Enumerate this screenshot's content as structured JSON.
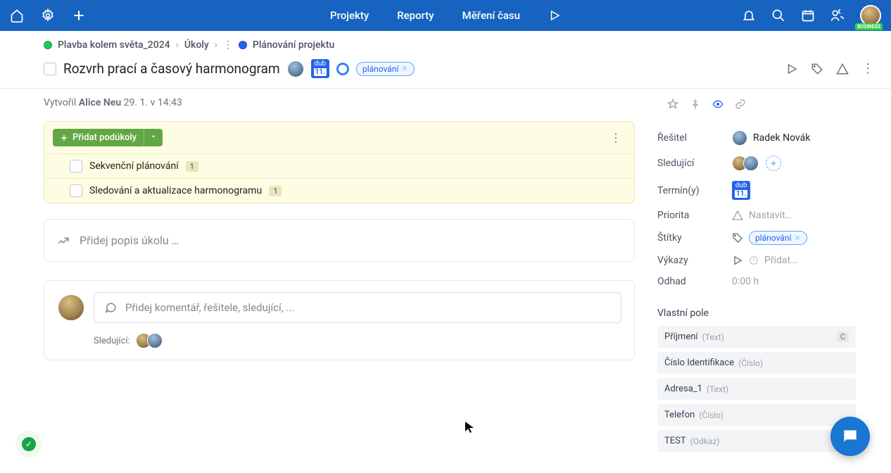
{
  "topnav": {
    "projects": "Projekty",
    "reports": "Reporty",
    "time": "Měření času",
    "badge": "BUSINESS"
  },
  "breadcrumb": {
    "project": "Plavba kolem světa_2024",
    "tasks": "Úkoly",
    "current": "Plánování projektu"
  },
  "task": {
    "title": "Rozvrh prací a časový harmonogram",
    "due_month": "dub",
    "due_day": "11.",
    "tag": "plánování",
    "created_prefix": "Vytvořil ",
    "created_author": "Alice Neu",
    "created_time": " 29. 1. v 14:43"
  },
  "subtasks": {
    "add_label": "Přidat podúkoly",
    "items": [
      {
        "title": "Sekvenční plánování",
        "count": "1"
      },
      {
        "title": "Sledování a aktualizace harmonogramu",
        "count": "1"
      }
    ]
  },
  "description_placeholder": "Přidej popis úkolu …",
  "comment": {
    "placeholder": "Přidej komentář, řešitele, sledující, ...",
    "followers_label": "Sledující:"
  },
  "sidebar": {
    "assignee_label": "Řešitel",
    "assignee_name": "Radek Novák",
    "followers_label": "Sledující",
    "dates_label": "Termín(y)",
    "due_month": "dub",
    "due_day": "11.",
    "priority_label": "Priorita",
    "priority_value": "Nastavit…",
    "tags_label": "Štítky",
    "tag": "plánování",
    "reports_label": "Výkazy",
    "reports_value": "Přidat…",
    "estimate_label": "Odhad",
    "estimate_value": "0:00 h",
    "custom_title": "Vlastní pole",
    "custom_fields": [
      {
        "name": "Příjmení",
        "type": "(Text)",
        "badge": "C"
      },
      {
        "name": "Číslo Identifikace",
        "type": "(Číslo)"
      },
      {
        "name": "Adresa_1",
        "type": "(Text)"
      },
      {
        "name": "Telefon",
        "type": "(Číslo)"
      },
      {
        "name": "TEST",
        "type": "(Odkaz)"
      }
    ]
  }
}
